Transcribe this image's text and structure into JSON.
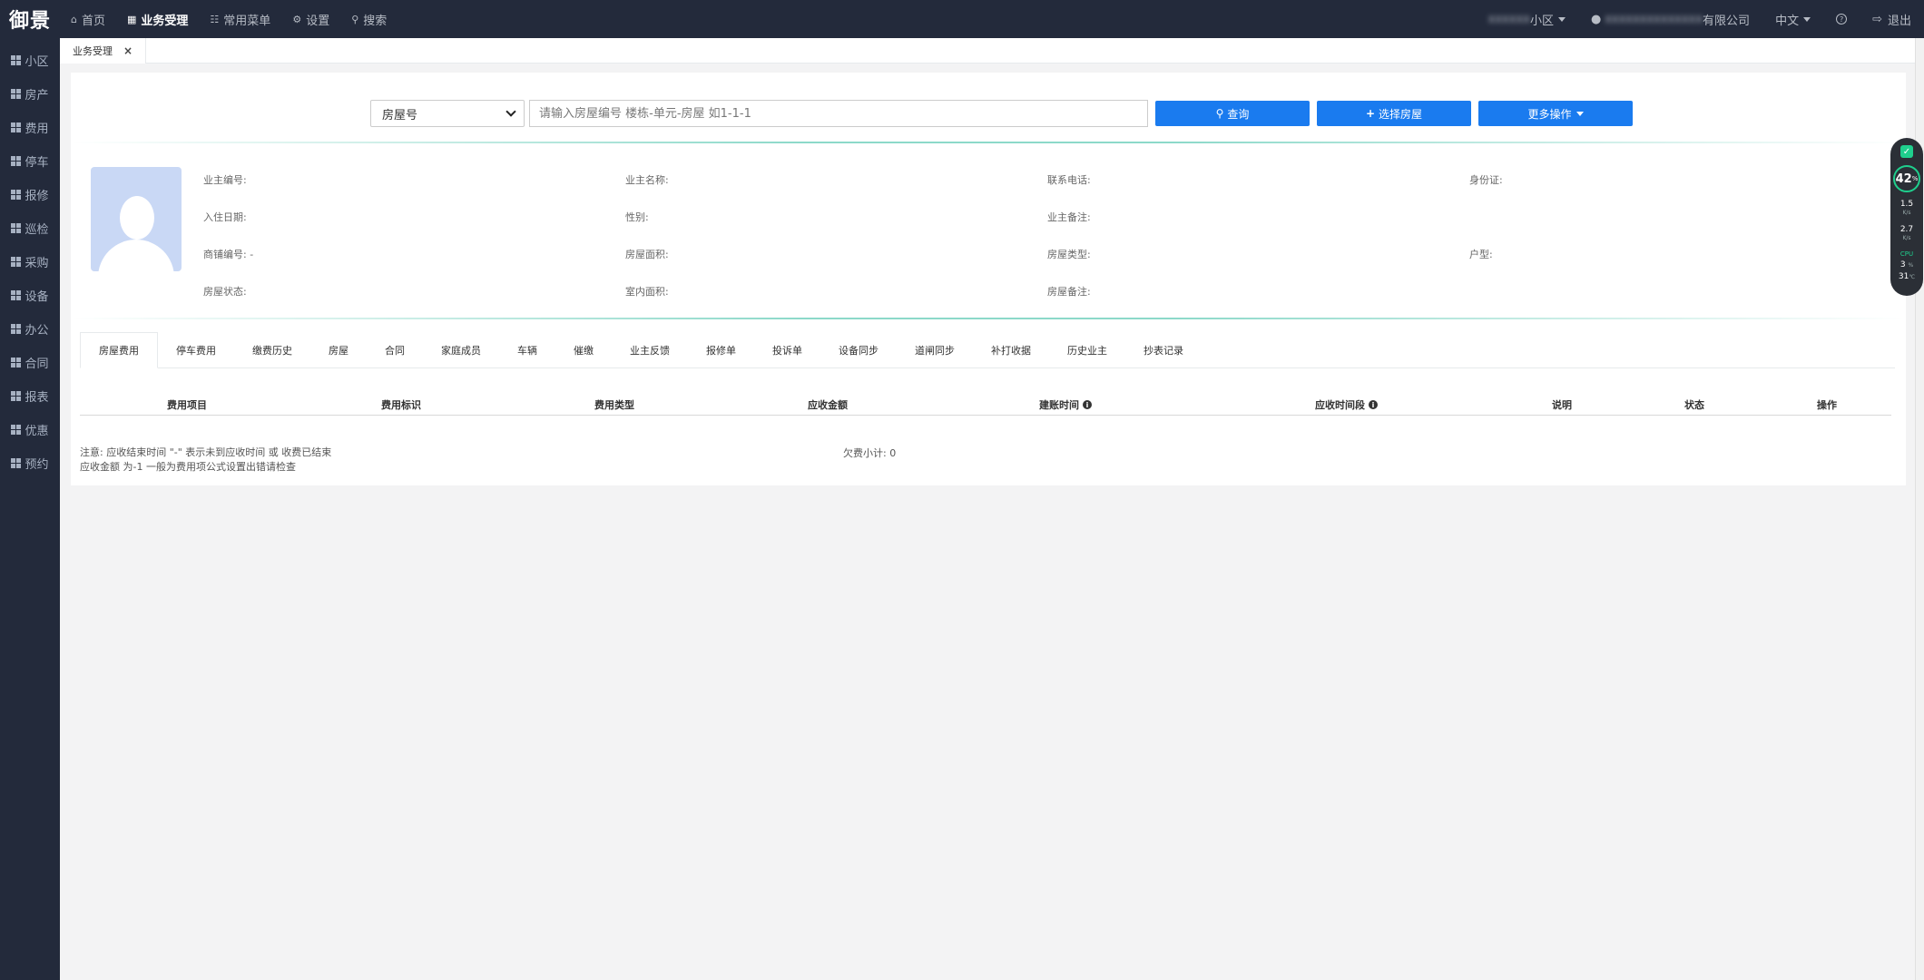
{
  "brand": "御景",
  "topnav": [
    {
      "icon": "home-icon",
      "glyph": "⌂",
      "label": "首页",
      "active": false
    },
    {
      "icon": "calculator-icon",
      "glyph": "▦",
      "label": "业务受理",
      "active": true
    },
    {
      "icon": "sitemap-icon",
      "glyph": "☷",
      "label": "常用菜单",
      "active": false
    },
    {
      "icon": "gear-icon",
      "glyph": "⚙",
      "label": "设置",
      "active": false
    },
    {
      "icon": "search-icon",
      "glyph": "⚲",
      "label": "搜索",
      "active": false
    }
  ],
  "topright": {
    "community": "小区",
    "company": "有限公司",
    "language": "中文",
    "help_glyph": "?",
    "logout": "退出"
  },
  "sidebar": [
    "小区",
    "房产",
    "费用",
    "停车",
    "报修",
    "巡检",
    "采购",
    "设备",
    "办公",
    "合同",
    "报表",
    "优惠",
    "预约"
  ],
  "page_tab": {
    "label": "业务受理",
    "close": "×"
  },
  "search": {
    "select_value": "房屋号",
    "placeholder": "请输入房屋编号 楼栋-单元-房屋 如1-1-1",
    "query_label": "查询",
    "choose_label": "选择房屋",
    "more_label": "更多操作"
  },
  "owner_info": {
    "row1": [
      "业主编号:",
      "业主名称:",
      "联系电话:",
      "身份证:"
    ],
    "row2": [
      "入住日期:",
      "性别:",
      "业主备注:",
      ""
    ],
    "row3": [
      "商铺编号: -",
      "房屋面积:",
      "房屋类型:",
      "户型:"
    ],
    "row4": [
      "房屋状态:",
      "室内面积:",
      "房屋备注:",
      ""
    ]
  },
  "tabs": [
    "房屋费用",
    "停车费用",
    "缴费历史",
    "房屋",
    "合同",
    "家庭成员",
    "车辆",
    "催缴",
    "业主反馈",
    "报修单",
    "投诉单",
    "设备同步",
    "道闸同步",
    "补打收据",
    "历史业主",
    "抄表记录"
  ],
  "table_headers": [
    "费用项目",
    "费用标识",
    "费用类型",
    "应收金额",
    "建账时间",
    "应收时间段",
    "说明",
    "状态",
    "操作"
  ],
  "notes": {
    "line1": "注意:  应收结束时间  \"-\"  表示未到应收时间 或 收费已结束",
    "line2": "应收金额 为-1 一般为费用项公式设置出错请检查",
    "subtotal": "欠费小计: 0"
  },
  "widget": {
    "percent": "42",
    "percent_unit": "%",
    "up": "1.5",
    "up_unit": "K/s",
    "down": "2.7",
    "down_unit": "K/s",
    "cpu_label": "CPU",
    "cpu": "3",
    "cpu_unit": "%",
    "temp": "31",
    "temp_unit": "℃"
  },
  "colors": {
    "primary": "#1a7bef",
    "nav_bg": "#232a3b",
    "accent": "#1ab394"
  }
}
